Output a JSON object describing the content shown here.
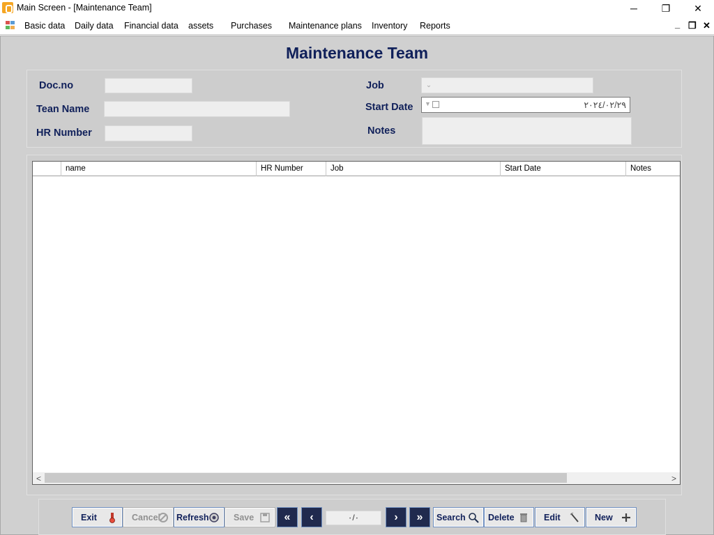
{
  "window": {
    "title": "Main Screen - [Maintenance Team]",
    "minimize_glyph": "─",
    "maximize_glyph": "❐",
    "close_glyph": "✕"
  },
  "menu": {
    "items": [
      "Basic data",
      "Daily data",
      "Financial data",
      "assets",
      "Purchases",
      "Maintenance plans",
      "Inventory",
      "Reports"
    ],
    "mdi_min": "_",
    "mdi_restore": "❐",
    "mdi_close": "✕"
  },
  "form": {
    "title": "Maintenance Team",
    "labels": {
      "doc_no": "Doc.no",
      "team_name": "Tean Name",
      "hr_number": "HR Number",
      "job": "Job",
      "start_date": "Start Date",
      "notes": "Notes"
    },
    "values": {
      "doc_no": "",
      "team_name": "",
      "hr_number": "",
      "job": "",
      "start_date": "٢٠٢٤/٠٢/٢٩",
      "notes": ""
    }
  },
  "grid": {
    "columns": [
      "name",
      "HR Number",
      "Job",
      "Start Date",
      "Notes"
    ],
    "rows": [],
    "scroll_left": "<",
    "scroll_right": ">"
  },
  "toolbar": {
    "exit": "Exit",
    "cancel": "Cancel",
    "refresh": "Refresh",
    "save": "Save",
    "first": "«",
    "prev": "‹",
    "pager": "٠/٠",
    "next": "›",
    "last": "»",
    "search": "Search",
    "delete": "Delete",
    "edit": "Edit",
    "new": "New"
  }
}
